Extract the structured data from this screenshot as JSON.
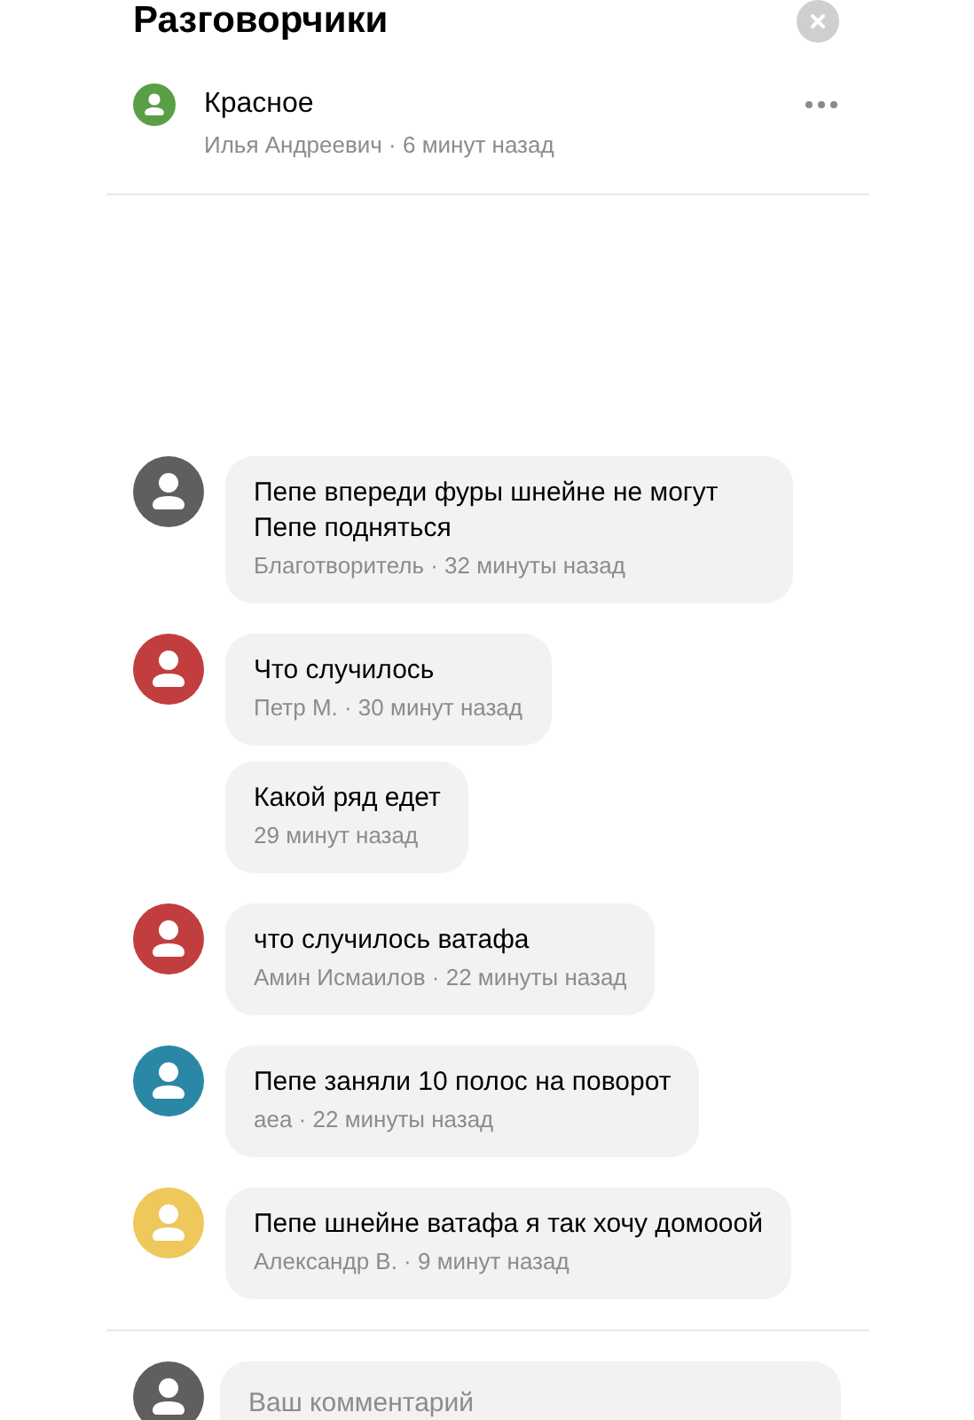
{
  "title": "Разговорчики",
  "post": {
    "title": "Красное",
    "meta": "Илья Андреевич · 6 минут назад",
    "color": "#5a9f46"
  },
  "comments": [
    {
      "kind": "first",
      "color": "#5f5f5f",
      "text": "Пепе впереди фуры шнейне не могут Пепе подняться",
      "meta": "Благотворитель · 32 минуты назад"
    },
    {
      "kind": "first",
      "color": "#c23e3e",
      "text": "Что случилось",
      "meta": "Петр М. · 30 минут назад"
    },
    {
      "kind": "follow-up",
      "text": "Какой ряд едет",
      "meta": "29 минут назад"
    },
    {
      "kind": "first",
      "color": "#c23e3e",
      "text": "что случилось ватафа",
      "meta": "Амин Исмаилов · 22 минуты назад"
    },
    {
      "kind": "first",
      "color": "#2b87a6",
      "text": "Пепе заняли 10 полос на поворот",
      "meta": "аеа · 22 минуты назад"
    },
    {
      "kind": "first",
      "color": "#eec85a",
      "text": "Пепе шнейне ватафа я так хочу домооой",
      "meta": "Александр В. · 9 минут назад"
    }
  ],
  "composer": {
    "placeholder": "Ваш комментарий",
    "color": "#5f5f5f"
  }
}
